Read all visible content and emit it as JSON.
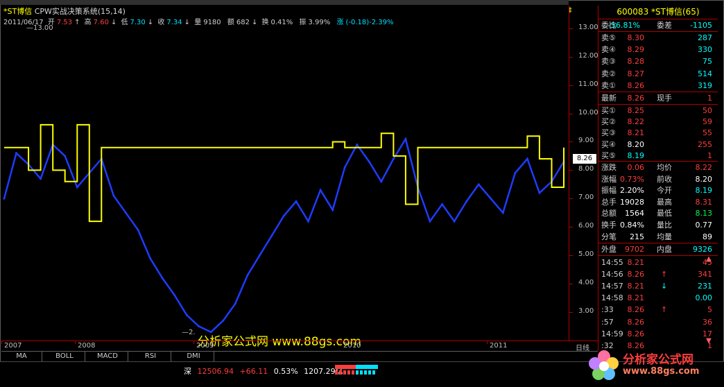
{
  "header": {
    "stock_name": "*ST博信",
    "indicator": "CPW实战决策系统(15,14)",
    "date": "2011/06/17",
    "open_label": "开",
    "open": "7.53",
    "high_label": "高",
    "high": "7.60",
    "low_label": "低",
    "low": "7.30",
    "close_label": "收",
    "close": "7.34",
    "volume_label": "量",
    "volume": "9180",
    "amount_label": "额",
    "amount": "682",
    "turnover_label": "换",
    "turnover": "0.41%",
    "amplitude_label": "振",
    "amplitude": "3.99%",
    "change_label": "涨",
    "change": "(-0.18)-2.39%"
  },
  "chart_data": {
    "type": "line",
    "x_labels": [
      "2007",
      "2008",
      "2009",
      "2010",
      "2011"
    ],
    "y_ticks": [
      "13.00",
      "12.00",
      "11.00",
      "10.00",
      "9.00",
      "8.00",
      "7.00",
      "6.00",
      "5.00",
      "4.00",
      "3.00"
    ],
    "ylim": [
      2.0,
      13.8
    ],
    "high_marker": "13.00",
    "low_marker": "2.",
    "current_price": "8.26",
    "series": [
      {
        "color": "#1e3cff",
        "values": [
          7.0,
          8.6,
          8.2,
          7.7,
          8.9,
          8.5,
          7.4,
          7.9,
          8.4,
          7.1,
          6.5,
          5.9,
          4.9,
          4.2,
          3.6,
          2.9,
          2.5,
          2.3,
          2.7,
          3.3,
          4.3,
          5.0,
          5.7,
          6.4,
          6.9,
          6.2,
          7.3,
          6.6,
          8.1,
          8.9,
          8.3,
          7.6,
          8.4,
          9.1,
          7.4,
          6.2,
          6.8,
          6.2,
          6.9,
          7.5,
          7.0,
          6.5,
          7.9,
          8.4,
          7.2,
          7.6,
          8.3
        ]
      },
      {
        "color": "#ffff00",
        "values": [
          8.8,
          8.8,
          8.0,
          9.6,
          8.0,
          7.6,
          9.6,
          6.2,
          8.8,
          8.8,
          8.8,
          8.8,
          8.8,
          8.8,
          8.8,
          8.8,
          8.8,
          8.8,
          8.8,
          8.8,
          8.8,
          8.8,
          8.8,
          8.8,
          8.8,
          8.8,
          8.8,
          9.0,
          8.8,
          8.8,
          8.8,
          9.3,
          8.5,
          6.8,
          8.8,
          8.8,
          8.8,
          8.8,
          8.8,
          8.8,
          8.8,
          8.8,
          8.8,
          9.2,
          8.4,
          7.4,
          8.8
        ]
      }
    ]
  },
  "watermark": "分析家公式网 www.88gs.com",
  "period": "日线",
  "quote": {
    "code_name": "600083 *ST博信(65)",
    "weibi_label": "委比",
    "weibi": "-56.81%",
    "weicha_label": "委差",
    "weicha": "-1105",
    "asks": [
      {
        "label": "卖⑤",
        "price": "8.30",
        "vol": "287"
      },
      {
        "label": "卖④",
        "price": "8.29",
        "vol": "330"
      },
      {
        "label": "卖③",
        "price": "8.28",
        "vol": "75"
      },
      {
        "label": "卖②",
        "price": "8.27",
        "vol": "514"
      },
      {
        "label": "卖①",
        "price": "8.26",
        "vol": "319"
      }
    ],
    "latest_label": "最新",
    "latest": "8.26",
    "xianshou_label": "现手",
    "xianshou": "1",
    "bids": [
      {
        "label": "买①",
        "price": "8.25",
        "vol": "50"
      },
      {
        "label": "买②",
        "price": "8.22",
        "vol": "59"
      },
      {
        "label": "买③",
        "price": "8.21",
        "vol": "55"
      },
      {
        "label": "买④",
        "price": "8.20",
        "vol": "255"
      },
      {
        "label": "买⑤",
        "price": "8.19",
        "vol": "1"
      }
    ],
    "stats": [
      {
        "l1": "涨跌",
        "v1": "0.06",
        "l2": "均价",
        "v2": "8.22",
        "c1": "red",
        "c2": "red"
      },
      {
        "l1": "涨幅",
        "v1": "0.73%",
        "l2": "前收",
        "v2": "8.20",
        "c1": "red",
        "c2": "white"
      },
      {
        "l1": "振幅",
        "v1": "2.20%",
        "l2": "今开",
        "v2": "8.19",
        "c1": "white",
        "c2": "cyan"
      },
      {
        "l1": "总手",
        "v1": "19028",
        "l2": "最高",
        "v2": "8.31",
        "c1": "white",
        "c2": "red"
      },
      {
        "l1": "总额",
        "v1": "1564",
        "l2": "最低",
        "v2": "8.13",
        "c1": "white",
        "c2": "green"
      },
      {
        "l1": "换手",
        "v1": "0.84%",
        "l2": "量比",
        "v2": "0.77",
        "c1": "white",
        "c2": "white"
      },
      {
        "l1": "分笔",
        "v1": "215",
        "l2": "均量",
        "v2": "89",
        "c1": "white",
        "c2": "white"
      }
    ],
    "outer_label": "外盘",
    "outer": "9702",
    "inner_label": "内盘",
    "inner": "9326",
    "ticks": [
      {
        "time": "14:55",
        "price": "8.21",
        "arrow": "",
        "vol": "45",
        "pc": "red",
        "vc": "red"
      },
      {
        "time": "14:56",
        "price": "8.26",
        "arrow": "↑",
        "vol": "341",
        "pc": "red",
        "vc": "red"
      },
      {
        "time": "14:57",
        "price": "8.21",
        "arrow": "↓",
        "vol": "231",
        "pc": "red",
        "vc": "cyan"
      },
      {
        "time": "14:58",
        "price": "8.21",
        "arrow": "",
        "vol": "0.00",
        "pc": "red",
        "vc": "cyan"
      },
      {
        "time": ":33",
        "price": "8.26",
        "arrow": "↑",
        "vol": "5",
        "pc": "red",
        "vc": "red"
      },
      {
        "time": ":57",
        "price": "8.26",
        "arrow": "",
        "vol": "36",
        "pc": "red",
        "vc": "red"
      },
      {
        "time": "14:59",
        "price": "8.26",
        "arrow": "",
        "vol": "17",
        "pc": "red",
        "vc": "red"
      },
      {
        "time": ":32",
        "price": "8.26",
        "arrow": "",
        "vol": "1",
        "pc": "red",
        "vc": "red"
      }
    ]
  },
  "tabs": [
    "MA",
    "BOLL",
    "MACD",
    "RSI",
    "DMI"
  ],
  "status": {
    "market": "深",
    "index": "12506.94",
    "delta": "+66.11",
    "pct": "0.53%",
    "amount": "1207.29亿"
  },
  "logo": {
    "text": "分析家公式网",
    "url": "www.88gs.com"
  },
  "colors": {
    "up": "#ff3c3c",
    "down": "#00ffff",
    "price_line": "#1e3cff",
    "decision_line": "#ffff00",
    "axis": "#b00000"
  }
}
